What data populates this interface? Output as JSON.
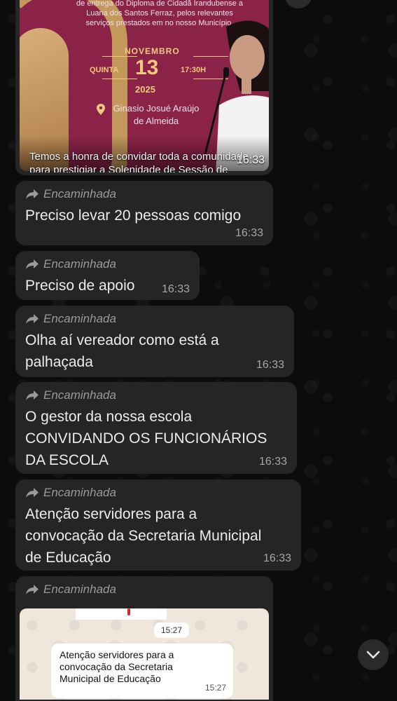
{
  "image_message": {
    "invite_text": "de entrega do Diploma de Cidadã Irandubense a\nLuana dos Santos Ferraz, pelos relevantes\nserviços prestados em no nosso Município.",
    "month": "NOVEMBRO",
    "weekday": "QUINTA",
    "day": "13",
    "hour": "17:30H",
    "year": "2025",
    "place": "Ginasio Josué Araújo\nde Almeida",
    "caption": "Temos a honra de convidar toda a comunidade para prestigiar a Solenidade de Sessão de",
    "time": "16:33"
  },
  "forward_label": "Encaminhada",
  "messages": [
    {
      "text": "Preciso levar 20 pessoas comigo",
      "time": "16:33"
    },
    {
      "text": "Preciso de apoio",
      "time": "16:33"
    },
    {
      "text": "Olha aí vereador como está a\npalhaçada",
      "time": "16:33"
    },
    {
      "text": "O gestor da nossa escola\nCONVIDANDO OS  FUNCIONÁRIOS\nDA ESCOLA",
      "time": "16:33"
    },
    {
      "text": "Atenção servidores para a\nconvocação da Secretaria Municipal\nde Educação",
      "time": "16:33"
    }
  ],
  "last_message": {
    "screenshot_time_pill": "15:27",
    "screenshot_text": "Atenção servidores para a\nconvocação da Secretaria\nMunicipal de Educação",
    "screenshot_time": "15:27"
  },
  "icons": {
    "forward": "forward-arrow-icon",
    "scroll_down": "chevron-down-icon",
    "location": "location-pin-icon"
  },
  "colors": {
    "bubble": "#252525",
    "invite_bg": "#8b2348",
    "gold": "#f2c97c"
  }
}
